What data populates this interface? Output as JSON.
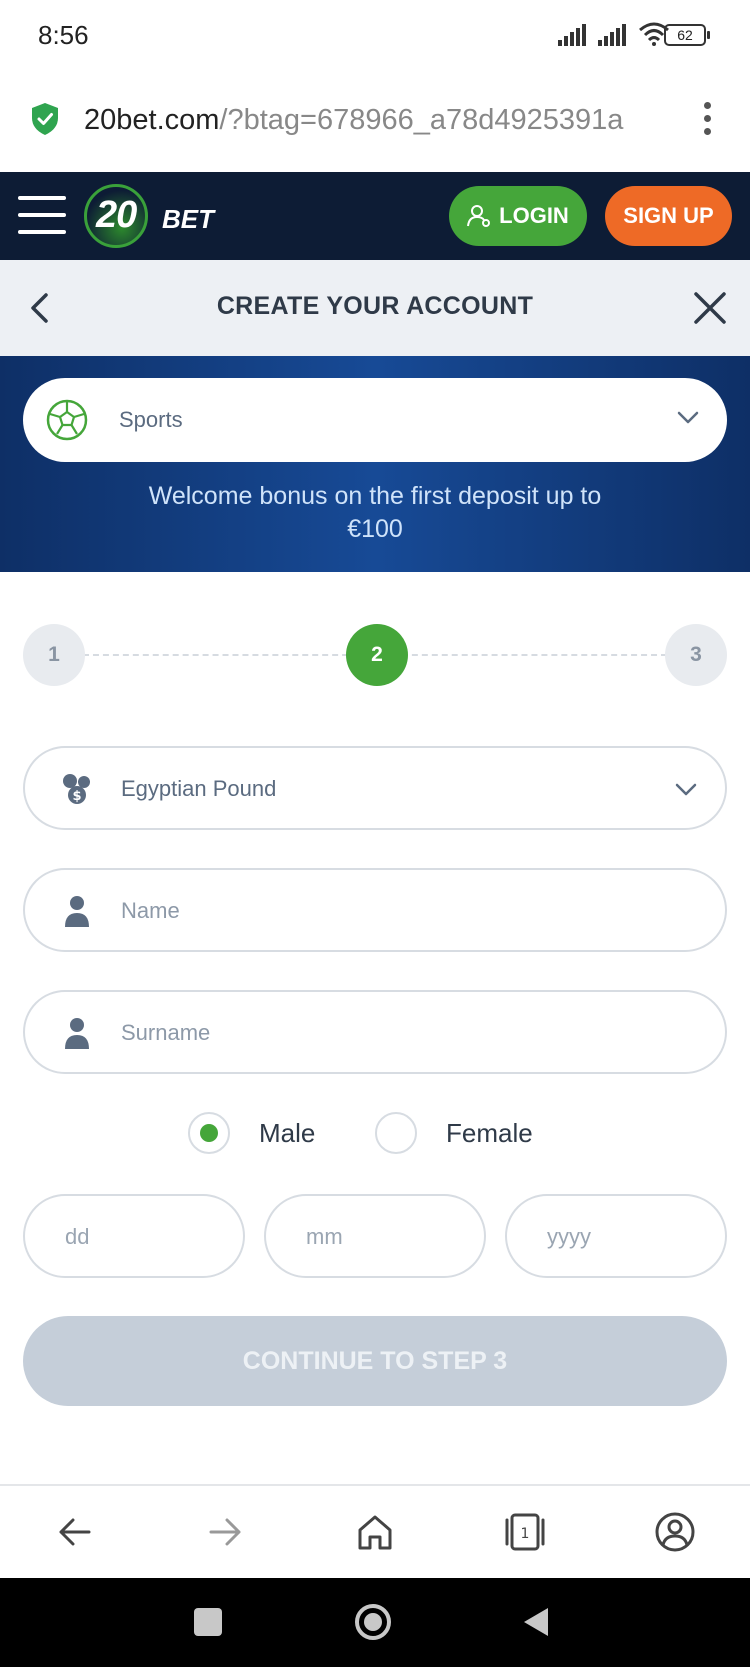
{
  "status_bar": {
    "time": "8:56",
    "battery": "62"
  },
  "browser": {
    "url_domain": "20bet.com",
    "url_path": "/?btag=678966_a78d4925391a"
  },
  "header": {
    "logo_number": "20",
    "logo_word": "BET",
    "login_label": "LOGIN",
    "signup_label": "SIGN UP",
    "brand_green": "#45a63a",
    "brand_orange": "#ee6a26"
  },
  "form": {
    "title": "CREATE YOUR ACCOUNT",
    "bonus_type": "Sports",
    "bonus_text_line1": "Welcome bonus on the first deposit up to",
    "bonus_text_line2": "€100",
    "steps": [
      "1",
      "2",
      "3"
    ],
    "active_step": "2",
    "currency": "Egyptian Pound",
    "name_placeholder": "Name",
    "surname_placeholder": "Surname",
    "gender_male": "Male",
    "gender_female": "Female",
    "gender_selected": "Male",
    "day_placeholder": "dd",
    "month_placeholder": "mm",
    "year_placeholder": "yyyy",
    "continue_label": "CONTINUE TO STEP 3"
  }
}
